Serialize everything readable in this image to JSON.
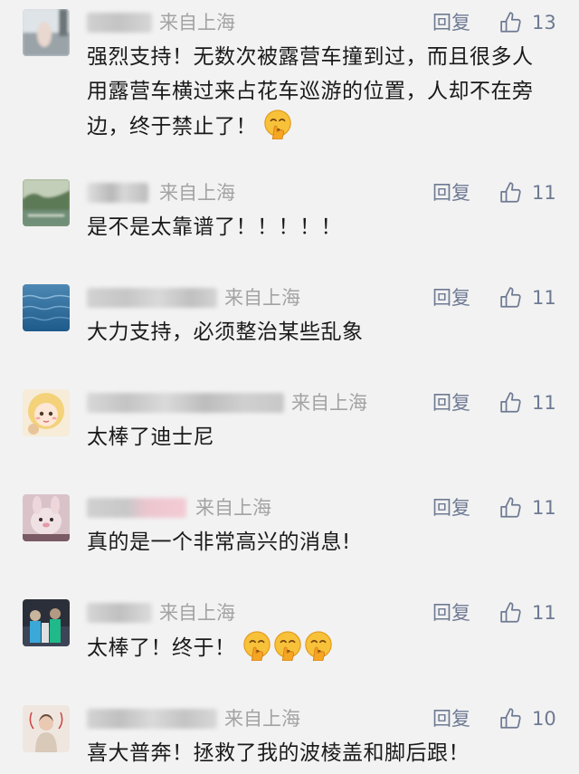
{
  "colors": {
    "background": "#f2f2f2",
    "meta_text": "#a3a3a3",
    "action_text": "#6e7a93",
    "content_text": "#1a1a1a"
  },
  "comments": [
    {
      "location": "来自上海",
      "reply_label": "回复",
      "like_count": "13",
      "text": "强烈支持！无数次被露营车撞到过，而且很多人用露营车横过来占花车巡游的位置，人却不在旁边，终于禁止了！",
      "emoji_icons": [
        "shushing-face-emoji"
      ]
    },
    {
      "location": "来自上海",
      "reply_label": "回复",
      "like_count": "11",
      "text": "是不是太靠谱了！！！！！",
      "emoji_icons": []
    },
    {
      "location": "来自上海",
      "reply_label": "回复",
      "like_count": "11",
      "text": "大力支持，必须整治某些乱象",
      "emoji_icons": []
    },
    {
      "location": "来自上海",
      "reply_label": "回复",
      "like_count": "11",
      "text": "太棒了迪士尼",
      "emoji_icons": []
    },
    {
      "location": "来自上海",
      "reply_label": "回复",
      "like_count": "11",
      "text": "真的是一个非常高兴的消息!",
      "emoji_icons": []
    },
    {
      "location": "来自上海",
      "reply_label": "回复",
      "like_count": "11",
      "text": "太棒了！终于！",
      "emoji_icons": [
        "shushing-face-emoji",
        "shushing-face-emoji",
        "shushing-face-emoji"
      ]
    },
    {
      "location": "来自上海",
      "reply_label": "回复",
      "like_count": "10",
      "text": "喜大普奔！拯救了我的波棱盖和脚后跟！",
      "emoji_icons": []
    }
  ]
}
